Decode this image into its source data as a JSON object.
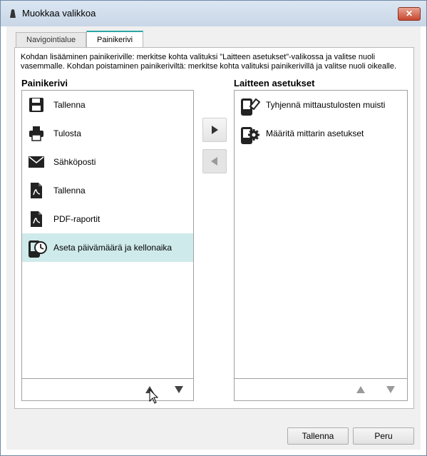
{
  "window": {
    "title": "Muokkaa valikkoa",
    "close_label": "✕"
  },
  "tabs": [
    {
      "label": "Navigointialue",
      "active": false
    },
    {
      "label": "Painikerivi",
      "active": true
    }
  ],
  "instructions": "Kohdan lisääminen painikeriville: merkitse kohta valituksi ”Laitteen asetukset”-valikossa ja valitse nuoli vasemmalle. Kohdan poistaminen painikeriviltä: merkitse kohta valituksi painikerivillä ja valitse nuoli oikealle.",
  "left_list": {
    "title": "Painikerivi",
    "items": [
      {
        "label": "Tallenna",
        "icon": "floppy-disk-icon",
        "selected": false
      },
      {
        "label": "Tulosta",
        "icon": "printer-icon",
        "selected": false
      },
      {
        "label": "Sähköposti",
        "icon": "envelope-icon",
        "selected": false
      },
      {
        "label": "Tallenna",
        "icon": "pdf-document-icon",
        "selected": false
      },
      {
        "label": "PDF-raportit",
        "icon": "pdf-document-icon",
        "selected": false
      },
      {
        "label": "Aseta päivämäärä ja kellonaika",
        "icon": "device-clock-icon",
        "selected": true
      }
    ]
  },
  "right_list": {
    "title": "Laitteen asetukset",
    "items": [
      {
        "label": "Tyhjennä mittaustulosten muisti",
        "icon": "device-eraser-icon",
        "selected": false
      },
      {
        "label": "Määritä mittarin asetukset",
        "icon": "device-gear-icon",
        "selected": false
      }
    ]
  },
  "buttons": {
    "ok": "Tallenna",
    "cancel": "Peru"
  },
  "colors": {
    "selected_row": "#cfeaea",
    "active_tab_accent": "#2ca6a6",
    "close_button": "#c6472f"
  }
}
